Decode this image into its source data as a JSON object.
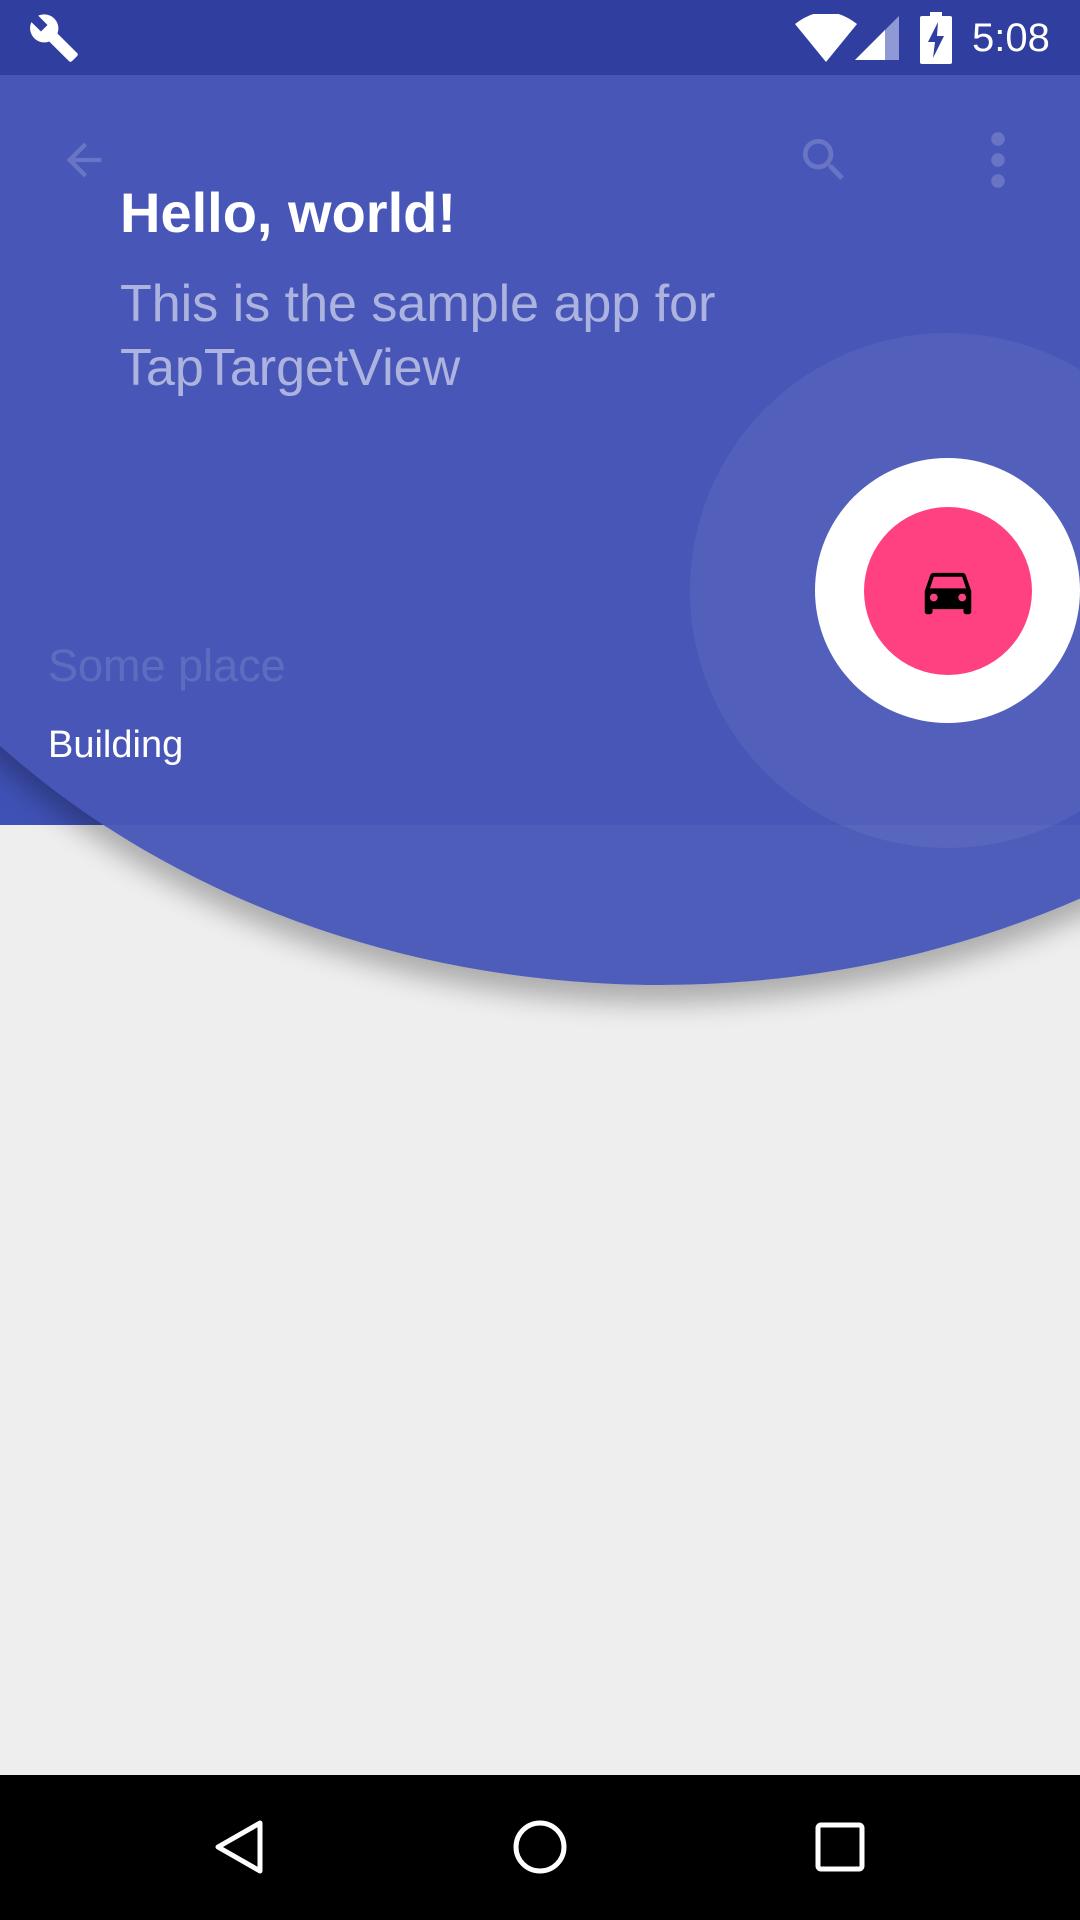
{
  "status_bar": {
    "time": "5:08",
    "icons": [
      "wrench-icon",
      "wifi-icon",
      "signal-icon",
      "battery-charging-icon"
    ],
    "background": "#303f9f"
  },
  "toolbar": {
    "icons": [
      "back-arrow-icon",
      "search-icon",
      "more-vert-icon"
    ],
    "background": "#3f51b5"
  },
  "header": {
    "title": "Some place",
    "subtitle": "Building"
  },
  "tap_target": {
    "title": "Hello, world!",
    "description": "This is the sample app for TapTargetView",
    "outer_circle_color": "#4858b7",
    "target_circle_color": "#ffffff",
    "button_color": "#ff4081",
    "button_icon": "car-icon"
  },
  "navigation_bar": {
    "buttons": [
      "back-triangle-icon",
      "home-circle-icon",
      "recents-square-icon"
    ]
  }
}
